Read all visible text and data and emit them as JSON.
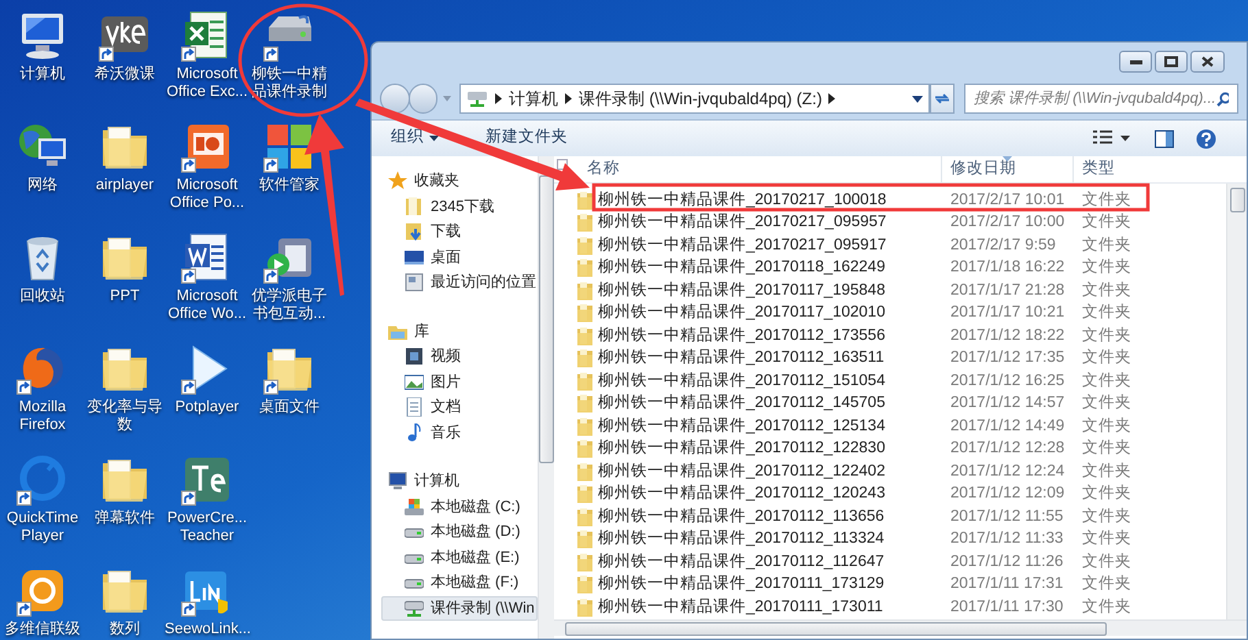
{
  "desktop_icons": [
    {
      "label": "计算机",
      "kind": "computer",
      "shortcut": false
    },
    {
      "label": "网络",
      "kind": "network",
      "shortcut": false
    },
    {
      "label": "回收站",
      "kind": "recycle",
      "shortcut": false
    },
    {
      "label": "Mozilla Firefox",
      "kind": "firefox",
      "shortcut": true
    },
    {
      "label": "QuickTime Player",
      "kind": "quicktime",
      "shortcut": true
    },
    {
      "label": "多维信联级",
      "kind": "orange",
      "shortcut": true
    },
    {
      "label": "希沃微课",
      "kind": "vke",
      "shortcut": true
    },
    {
      "label": "airplayer",
      "kind": "folder",
      "shortcut": false
    },
    {
      "label": "PPT",
      "kind": "folder",
      "shortcut": false
    },
    {
      "label": "变化率与导数",
      "kind": "folder",
      "shortcut": false
    },
    {
      "label": "弹幕软件",
      "kind": "folder",
      "shortcut": false
    },
    {
      "label": "数列",
      "kind": "folder",
      "shortcut": false
    },
    {
      "label": "Microsoft Office Exc...",
      "kind": "excel",
      "shortcut": true
    },
    {
      "label": "Microsoft Office Po...",
      "kind": "powerpoint",
      "shortcut": true
    },
    {
      "label": "Microsoft Office Wo...",
      "kind": "word",
      "shortcut": true
    },
    {
      "label": "Potplayer",
      "kind": "player",
      "shortcut": true
    },
    {
      "label": "PowerCre... Teacher",
      "kind": "te",
      "shortcut": true
    },
    {
      "label": "SeewoLink...",
      "kind": "link",
      "shortcut": true
    },
    {
      "label": "柳铁一中精品课件录制",
      "kind": "drive",
      "shortcut": true
    },
    {
      "label": "软件管家",
      "kind": "apps",
      "shortcut": true
    },
    {
      "label": "优学派电子书包互动...",
      "kind": "device",
      "shortcut": true
    },
    {
      "label": "桌面文件",
      "kind": "folder",
      "shortcut": true
    }
  ],
  "explorer": {
    "address": [
      "计算机",
      "课件录制 (\\\\Win-jvqubald4pq) (Z:)"
    ],
    "search": {
      "placeholder": "搜索 课件录制 (\\\\Win-jvqubald4pq)..."
    },
    "toolbar": {
      "organize": "组织",
      "new_folder": "新建文件夹"
    },
    "nav": [
      {
        "label": "收藏夹",
        "kind": "star",
        "selected": false,
        "children": [
          {
            "label": "2345下载",
            "kind": "folder",
            "selected": false
          },
          {
            "label": "下载",
            "kind": "download",
            "selected": false
          },
          {
            "label": "桌面",
            "kind": "desktop",
            "selected": false
          },
          {
            "label": "最近访问的位置",
            "kind": "recent",
            "selected": false
          }
        ]
      },
      {
        "label": "库",
        "kind": "library",
        "selected": false,
        "children": [
          {
            "label": "视频",
            "kind": "video",
            "selected": false
          },
          {
            "label": "图片",
            "kind": "picture",
            "selected": false
          },
          {
            "label": "文档",
            "kind": "document",
            "selected": false
          },
          {
            "label": "音乐",
            "kind": "music",
            "selected": false
          }
        ]
      },
      {
        "label": "计算机",
        "kind": "computer",
        "selected": false,
        "children": [
          {
            "label": "本地磁盘 (C:)",
            "kind": "system-disk",
            "selected": false
          },
          {
            "label": "本地磁盘 (D:)",
            "kind": "disk",
            "selected": false
          },
          {
            "label": "本地磁盘 (E:)",
            "kind": "disk",
            "selected": false
          },
          {
            "label": "本地磁盘 (F:)",
            "kind": "disk",
            "selected": false
          },
          {
            "label": "课件录制 (\\\\Win",
            "kind": "network-disk",
            "selected": true
          }
        ]
      }
    ],
    "columns": [
      "名称",
      "修改日期",
      "类型"
    ],
    "rows": [
      [
        "柳州铁一中精品课件_20170217_100018",
        "2017/2/17 10:01",
        "文件夹"
      ],
      [
        "柳州铁一中精品课件_20170217_095957",
        "2017/2/17 10:00",
        "文件夹"
      ],
      [
        "柳州铁一中精品课件_20170217_095917",
        "2017/2/17 9:59",
        "文件夹"
      ],
      [
        "柳州铁一中精品课件_20170118_162249",
        "2017/1/18 16:22",
        "文件夹"
      ],
      [
        "柳州铁一中精品课件_20170117_195848",
        "2017/1/17 21:28",
        "文件夹"
      ],
      [
        "柳州铁一中精品课件_20170117_102010",
        "2017/1/17 10:21",
        "文件夹"
      ],
      [
        "柳州铁一中精品课件_20170112_173556",
        "2017/1/12 18:22",
        "文件夹"
      ],
      [
        "柳州铁一中精品课件_20170112_163511",
        "2017/1/12 17:35",
        "文件夹"
      ],
      [
        "柳州铁一中精品课件_20170112_151054",
        "2017/1/12 16:25",
        "文件夹"
      ],
      [
        "柳州铁一中精品课件_20170112_145705",
        "2017/1/12 14:57",
        "文件夹"
      ],
      [
        "柳州铁一中精品课件_20170112_125134",
        "2017/1/12 14:49",
        "文件夹"
      ],
      [
        "柳州铁一中精品课件_20170112_122830",
        "2017/1/12 12:28",
        "文件夹"
      ],
      [
        "柳州铁一中精品课件_20170112_122402",
        "2017/1/12 12:24",
        "文件夹"
      ],
      [
        "柳州铁一中精品课件_20170112_120243",
        "2017/1/12 12:09",
        "文件夹"
      ],
      [
        "柳州铁一中精品课件_20170112_113656",
        "2017/1/12 11:55",
        "文件夹"
      ],
      [
        "柳州铁一中精品课件_20170112_113324",
        "2017/1/12 11:33",
        "文件夹"
      ],
      [
        "柳州铁一中精品课件_20170112_112647",
        "2017/1/12 11:26",
        "文件夹"
      ],
      [
        "柳州铁一中精品课件_20170111_173129",
        "2017/1/11 17:31",
        "文件夹"
      ],
      [
        "柳州铁一中精品课件_20170111_173011",
        "2017/1/11 17:30",
        "文件夹"
      ]
    ]
  }
}
